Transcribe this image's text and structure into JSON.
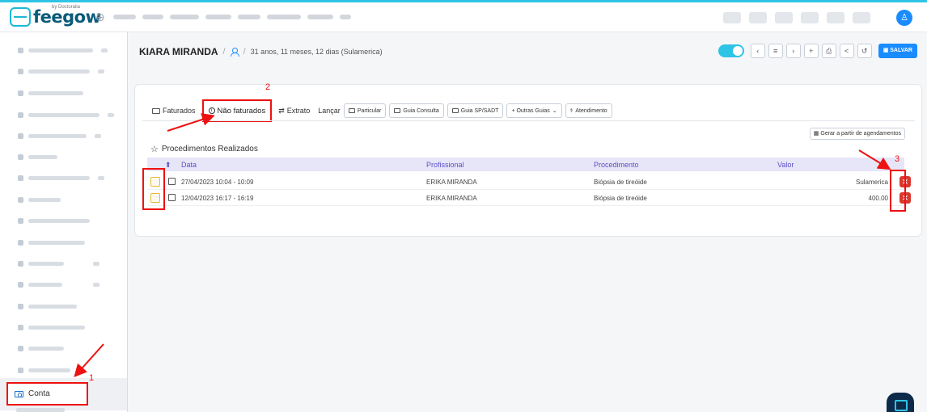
{
  "brand": {
    "name": "feegow",
    "by": "by Doctoralia"
  },
  "patient": {
    "name": "KIARA MIRANDA",
    "age": "31 anos, 11 meses, 12 dias (Sulamerica)"
  },
  "toolbar": {
    "save_label": "SALVAR"
  },
  "sidebar": {
    "active_item": "Conta"
  },
  "tabs": {
    "faturados": "Faturados",
    "nao_faturados": "Não faturados",
    "extrato": "Extrato",
    "lancar": "Lançar"
  },
  "launch_buttons": {
    "particular": "Particular",
    "guia_consulta": "Guia Consulta",
    "guia_sp": "Guia SP/SADT",
    "outras": "+ Outras Guias",
    "atendimento": "Atendimento"
  },
  "gerar_label": "Gerar a partir de agendamentos",
  "section_title": "Procedimentos Realizados",
  "table": {
    "headers": {
      "data": "Data",
      "profissional": "Profissional",
      "procedimento": "Procedimento",
      "valor": "Valor"
    },
    "rows": [
      {
        "data": "27/04/2023 10:04 - 10:09",
        "profissional": "ERIKA MIRANDA",
        "procedimento": "Biópsia de tireóide",
        "valor": "Sulamerica"
      },
      {
        "data": "12/04/2023 16:17 - 16:19",
        "profissional": "ERIKA MIRANDA",
        "procedimento": "Biópsia de tireóide",
        "valor": "400.00"
      }
    ]
  },
  "annotations": {
    "n1": "1",
    "n2": "2",
    "n3": "3"
  },
  "colors": {
    "accent": "#1a8cff",
    "highlight": "#ee1111",
    "header_text": "#5b4fc7",
    "delete": "#d9382e"
  }
}
